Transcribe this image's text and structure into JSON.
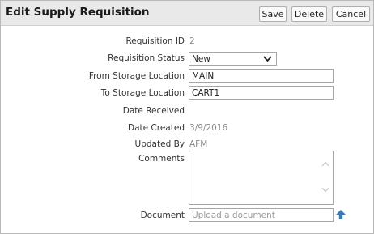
{
  "dialog": {
    "title": "Edit Supply Requisition",
    "buttons": {
      "save": "Save",
      "delete": "Delete",
      "cancel": "Cancel"
    }
  },
  "form": {
    "requisition_id": {
      "label": "Requisition ID",
      "value": "2"
    },
    "requisition_status": {
      "label": "Requisition Status",
      "value": "New"
    },
    "from_storage_location": {
      "label": "From Storage Location",
      "value": "MAIN"
    },
    "to_storage_location": {
      "label": "To Storage Location",
      "value": "CART1"
    },
    "date_received": {
      "label": "Date Received",
      "value": ""
    },
    "date_created": {
      "label": "Date Created",
      "value": "3/9/2016"
    },
    "updated_by": {
      "label": "Updated By",
      "value": "AFM"
    },
    "comments": {
      "label": "Comments",
      "value": ""
    },
    "document": {
      "label": "Document",
      "placeholder": "Upload a document"
    }
  },
  "colors": {
    "titlebar_bg": "#e9e9e9",
    "upload_icon": "#3b79b7"
  }
}
